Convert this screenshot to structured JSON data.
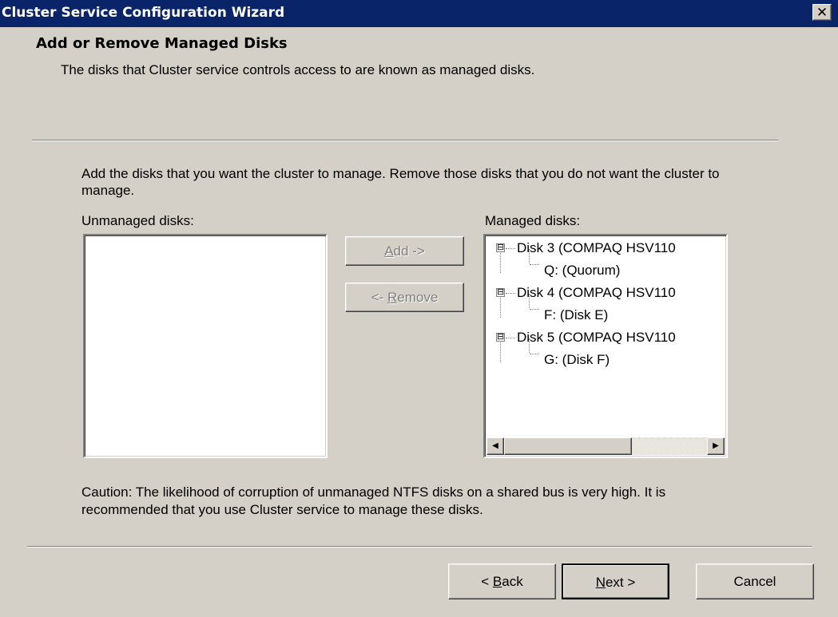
{
  "window": {
    "title": "Cluster Service Configuration Wizard",
    "close_glyph": "✕"
  },
  "header": {
    "title": "Add or Remove Managed Disks",
    "subtitle": "The disks that Cluster service controls access to are known as managed disks."
  },
  "instructions": "Add the disks that you want the cluster to manage. Remove those disks that you do not want the cluster to manage.",
  "unmanaged": {
    "label": "Unmanaged disks:",
    "items": []
  },
  "managed": {
    "label": "Managed disks:",
    "tree": [
      {
        "disk": "Disk 3 (COMPAQ  HSV110",
        "child": "Q: (Quorum)"
      },
      {
        "disk": "Disk 4 (COMPAQ  HSV110",
        "child": "F: (Disk E)"
      },
      {
        "disk": "Disk 5 (COMPAQ  HSV110",
        "child": "G: (Disk F)"
      }
    ]
  },
  "buttons": {
    "add": {
      "mnemonic": "A",
      "rest": "dd ->"
    },
    "remove": {
      "pre": "<- ",
      "mnemonic": "R",
      "rest": "emove"
    },
    "back": {
      "pre": "< ",
      "mnemonic": "B",
      "rest": "ack"
    },
    "next": {
      "mnemonic": "N",
      "rest": "ext >"
    },
    "cancel": "Cancel"
  },
  "caution": "Caution: The likelihood of corruption of unmanaged NTFS disks on a shared bus is very high. It is recommended that you use Cluster service to manage these disks.",
  "icons": {
    "expander": "⊟",
    "scroll_left": "◀",
    "scroll_right": "▶"
  },
  "colors": {
    "titlebar": "#0a246a",
    "face": "#d4d0c8"
  }
}
